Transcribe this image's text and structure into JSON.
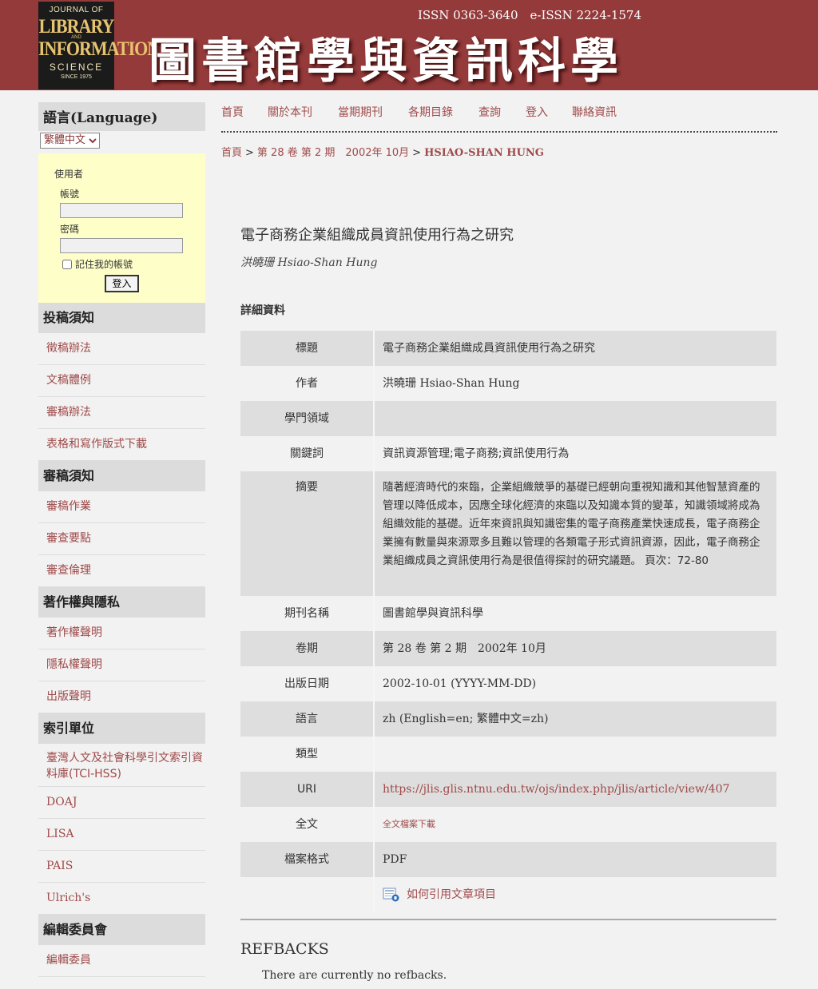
{
  "header": {
    "logo": {
      "line1": "JOURNAL OF",
      "line2": "LIBRARY",
      "line3": "AND",
      "line4": "INFORMATION",
      "line5": "SCIENCE",
      "line6": "SINCE 1975"
    },
    "issn": "ISSN 0363-3640　e-ISSN 2224-1574",
    "site_title": "圖書館學與資訊科學",
    "colors": {
      "banner": "#953a3a",
      "link": "#a04a4a"
    }
  },
  "sidebar": {
    "language": {
      "heading": "語言(Language)",
      "selected": "繁體中文"
    },
    "user": {
      "title": "使用者",
      "username_label": "帳號",
      "password_label": "密碼",
      "remember_label": "記住我的帳號",
      "login_button": "登入"
    },
    "sections": [
      {
        "heading": "投稿須知",
        "links": [
          "徵稿辦法",
          "文稿體例",
          "審稿辦法",
          "表格和寫作版式下載"
        ]
      },
      {
        "heading": "審稿須知",
        "links": [
          "審稿作業",
          "審查要點",
          "審查倫理"
        ]
      },
      {
        "heading": "著作權與隱私",
        "links": [
          "著作權聲明",
          "隱私權聲明",
          "出版聲明"
        ]
      },
      {
        "heading": "索引單位",
        "links": [
          "臺灣人文及社會科學引文索引資料庫(TCI-HSS)",
          "DOAJ",
          "LISA",
          "PAIS",
          "Ulrich's"
        ]
      },
      {
        "heading": "編輯委員會",
        "links": [
          "編輯委員"
        ]
      }
    ]
  },
  "nav": {
    "items": [
      "首頁",
      "關於本刊",
      "當期期刊",
      "各期目錄",
      "查詢",
      "登入",
      "聯絡資訊"
    ]
  },
  "breadcrumb": {
    "home": "首頁",
    "issue": "第 28 卷 第 2 期　2002年 10月",
    "current": "HSIAO-SHAN HUNG",
    "sep": ">"
  },
  "article": {
    "title": "電子商務企業組織成員資訊使用行為之研究",
    "author": "洪曉珊 Hsiao-Shan Hung",
    "details_heading": "詳細資料",
    "meta": [
      {
        "key": "標題",
        "value": "電子商務企業組織成員資訊使用行為之研究"
      },
      {
        "key": "作者",
        "value": "洪曉珊 Hsiao-Shan Hung"
      },
      {
        "key": "學門領域",
        "value": ""
      },
      {
        "key": "關鍵詞",
        "value": "資訊資源管理;電子商務;資訊使用行為"
      },
      {
        "key": "摘要",
        "value": "隨著經濟時代的來臨，企業組織競爭的基礎已經朝向重視知識和其他智慧資產的管理以降低成本，因應全球化經濟的來臨以及知識本質的變革，知識領域將成為組織效能的基礎。近年來資訊與知識密集的電子商務產業快速成長，電子商務企業擁有數量與來源眾多且難以管理的各類電子形式資訊資源，因此，電子商務企業組織成員之資訊使用行為是很值得探討的研究議題。 頁次：72-80"
      },
      {
        "key": "期刊名稱",
        "value": "圖書館學與資訊科學"
      },
      {
        "key": "卷期",
        "value": "第 28 卷 第 2 期　2002年 10月"
      },
      {
        "key": "出版日期",
        "value": "2002-10-01 (YYYY-MM-DD)"
      },
      {
        "key": "語言",
        "value": "zh (English=en; 繁體中文=zh)"
      },
      {
        "key": "類型",
        "value": ""
      },
      {
        "key": "URI",
        "value": "https://jlis.glis.ntnu.edu.tw/ojs/index.php/jlis/article/view/407"
      },
      {
        "key": "全文",
        "value": "全文檔案下載"
      },
      {
        "key": "檔案格式",
        "value": "PDF"
      }
    ],
    "cite_label": "如何引用文章項目"
  },
  "refbacks": {
    "heading": "REFBACKS",
    "text": "There are currently no refbacks."
  }
}
